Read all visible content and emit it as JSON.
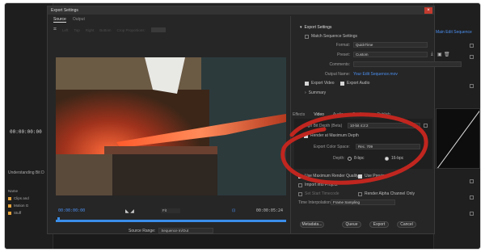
{
  "dialog": {
    "title": "Export Settings",
    "close_glyph": "×"
  },
  "tabs": [
    "Source",
    "Output"
  ],
  "crop_toolbar": {
    "left": "Left",
    "top": "Top",
    "right": "Right",
    "bottom": "Bottom",
    "aspect": "Crop Proportions:"
  },
  "timeline": {
    "in_tc": "00:00:00:00",
    "out_tc": "00:00:05:24",
    "fit": "Fit",
    "source_range_label": "Source Range:",
    "source_range_value": "Sequence In/Out"
  },
  "export_settings": {
    "header": "Export Settings",
    "match_sequence": "Match Sequence Settings",
    "format_label": "Format:",
    "format_value": "QuickTime",
    "preset_label": "Preset:",
    "preset_value": "Custom",
    "comments_label": "Comments:",
    "output_name_label": "Output Name:",
    "output_name_value": "Your Edit Sequence.mov",
    "export_video": "Export Video",
    "export_audio": "Export Audio",
    "summary": "Summary"
  },
  "settings_tabs": [
    "Effects",
    "Video",
    "Audio",
    "Captions",
    "Publish"
  ],
  "video": {
    "codec_label": "High Bit Depth (Beta)",
    "codec_value": "10-bit 4:2:2",
    "render_max_depth": "Render at Maximum Depth",
    "color_space_label": "Export Color Space:",
    "color_space_value": "Rec. 709",
    "depth_label": "Depth:",
    "depth_8": "8-bpc",
    "depth_16": "16-bpc"
  },
  "options": {
    "max_render_quality": "Use Maximum Render Quality",
    "use_previews": "Use Previews",
    "import_into_project": "Import into Project",
    "set_start_tc": "Set Start Timecode",
    "render_alpha": "Render Alpha Channel Only",
    "time_interp_label": "Time Interpolation:",
    "time_interp_value": "Frame Sampling"
  },
  "buttons": {
    "metadata": "Metadata...",
    "queue": "Queue",
    "export": "Export",
    "cancel": "Cancel"
  },
  "background": {
    "timecode": "00:00:00:00",
    "project_label": "Understanding Bit D",
    "list_header": "Name",
    "list_items": [
      "Clips and",
      "Motion G",
      "Stuff"
    ],
    "link": "Main Edit Sequence"
  },
  "colors": {
    "accent": "#4b8ff0",
    "annotation": "#c0261f",
    "close": "#c33b2f"
  }
}
